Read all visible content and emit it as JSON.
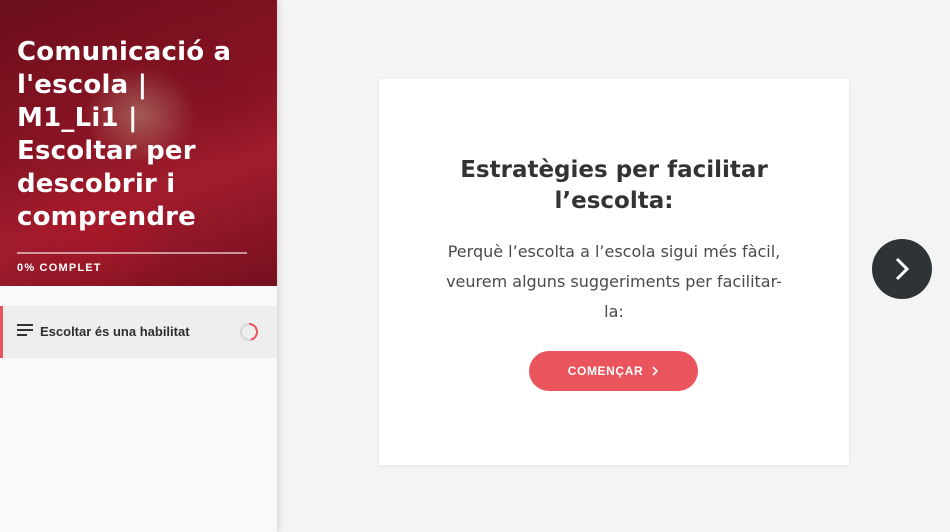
{
  "sidebar": {
    "course_title": "Comunicació a l'escola | M1_Li1 | Escoltar per descobrir i comprendre",
    "progress": {
      "label": "0% COMPLET",
      "percent": 0
    },
    "lessons": [
      {
        "label": "Escoltar és una habilitat",
        "icon": "menu-lines-icon",
        "status_icon": "progress-ring-icon",
        "active": true
      }
    ]
  },
  "card": {
    "heading_lines": [
      "Estratègies per facilitar",
      "l’escolta:"
    ],
    "body_lines": [
      "Perquè l’escolta a l’escola sigui més fàcil,",
      "veurem alguns suggeriments per facilitar-",
      "la:"
    ],
    "start_button_label": "COMENÇAR",
    "start_button_icon": "chevron-right-icon"
  },
  "navigation": {
    "next_icon": "chevron-right-icon"
  },
  "colors": {
    "accent": "#e9545d",
    "nav_button": "#2e3336",
    "text_dark": "#333333",
    "background": "#f4f4f4"
  }
}
